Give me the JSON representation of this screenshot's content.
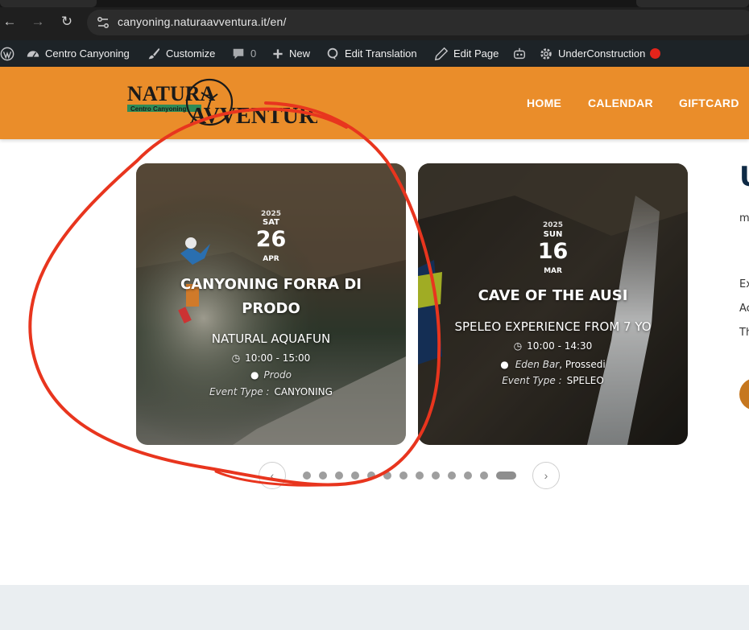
{
  "browser": {
    "url": "canyoning.naturaavventura.it/en/"
  },
  "admin_bar": {
    "site_name": "Centro Canyoning",
    "customize": "Customize",
    "comments_count": "0",
    "new": "New",
    "edit_translation": "Edit Translation",
    "edit_page": "Edit Page",
    "under_construction": "UnderConstruction"
  },
  "header": {
    "logo_text_top": "NATURA",
    "logo_text_bottom": "AVVENTURA",
    "logo_band": "Centro Canyoning",
    "menu": [
      "HOME",
      "CALENDAR",
      "GIFTCARD"
    ]
  },
  "events": [
    {
      "year": "2025",
      "weekday": "SAT",
      "day": "26",
      "month": "APR",
      "title": "CANYONING FORRA DI PRODO",
      "subtitle": "NATURAL AQUAFUN",
      "time": "10:00 - 15:00",
      "location": "Prodo",
      "event_type_label": "Event Type :",
      "event_type": "CANYONING"
    },
    {
      "year": "2025",
      "weekday": "SUN",
      "day": "16",
      "month": "MAR",
      "title": "CAVE OF THE AUSI",
      "subtitle": "SPELEO EXPERIENCE FROM 7 YO",
      "time": "10:00 - 14:30",
      "location_venue": "Eden Bar",
      "location_city": ", Prossedi",
      "event_type_label": "Event Type :",
      "event_type": "SPELEO"
    }
  ],
  "side_column": {
    "heading_fragment": "U",
    "line1": "m",
    "line2": "Ex",
    "line3": "Ac",
    "line4": "Th"
  },
  "carousel": {
    "dot_count": 13,
    "active_index": 12
  },
  "colors": {
    "header_orange": "#ea8d2a",
    "admin_bar": "#1d2327",
    "annotation_red": "#e8351e",
    "footer_band": "#eaeef1"
  },
  "icons": [
    "back-arrow-icon",
    "forward-arrow-icon",
    "reload-icon",
    "site-settings-icon",
    "wordpress-icon",
    "dashboard-icon",
    "brush-icon",
    "comment-icon",
    "plus-icon",
    "translate-icon",
    "pencil-icon",
    "robot-icon",
    "gear-icon",
    "clock-icon",
    "map-pin-icon",
    "chevron-left-icon",
    "chevron-right-icon"
  ]
}
